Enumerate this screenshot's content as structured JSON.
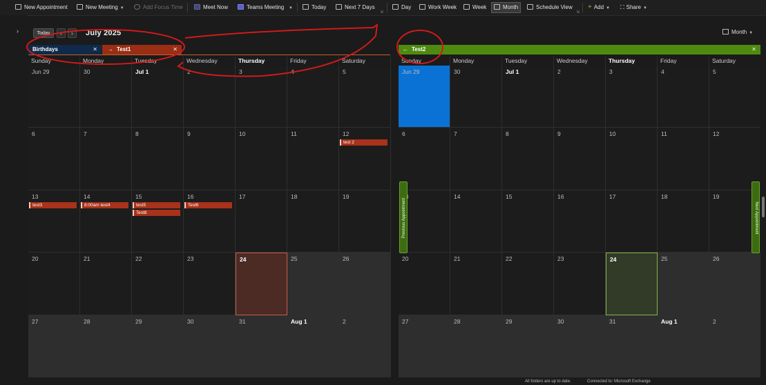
{
  "toolbar": {
    "new_appointment": "New Appointment",
    "new_meeting": "New Meeting",
    "add_focus_time": "Add Focus Time",
    "meet_now": "Meet Now",
    "teams_meeting": "Teams Meeting",
    "today": "Today",
    "next_7_days": "Next 7 Days",
    "day": "Day",
    "work_week": "Work Week",
    "week": "Week",
    "month": "Month",
    "schedule_view": "Schedule View",
    "add": "Add",
    "share": "Share"
  },
  "nav": {
    "today_btn": "Today",
    "month_title": "July 2025",
    "view_select": "Month",
    "expand_glyph": "›"
  },
  "left_calendar": {
    "tabs": [
      {
        "label": "Birthdays",
        "color": "#0f2a4a"
      },
      {
        "label": "Test1",
        "color": "#9a2e14"
      }
    ],
    "weekdays": [
      "Sunday",
      "Monday",
      "Tuesday",
      "Wednesday",
      "Thursday",
      "Friday",
      "Saturday"
    ],
    "weeks": [
      [
        "Jun 29",
        "30",
        "Jul 1",
        "2",
        "3",
        "4",
        "5"
      ],
      [
        "6",
        "7",
        "8",
        "9",
        "10",
        "11",
        "12"
      ],
      [
        "13",
        "14",
        "15",
        "16",
        "17",
        "18",
        "19"
      ],
      [
        "20",
        "21",
        "22",
        "23",
        "24",
        "25",
        "26"
      ],
      [
        "27",
        "28",
        "29",
        "30",
        "31",
        "Aug 1",
        "2"
      ]
    ],
    "events": [
      {
        "week": 1,
        "day": 6,
        "slot": 0,
        "label": "test 2"
      },
      {
        "week": 2,
        "day": 0,
        "slot": 0,
        "label": "test3"
      },
      {
        "week": 2,
        "day": 1,
        "slot": 0,
        "label": "8:00am test4"
      },
      {
        "week": 2,
        "day": 2,
        "slot": 0,
        "label": "test5"
      },
      {
        "week": 2,
        "day": 2,
        "slot": 1,
        "label": "Test8"
      },
      {
        "week": 2,
        "day": 3,
        "slot": 0,
        "label": "Test6"
      }
    ]
  },
  "right_calendar": {
    "tabs": [
      {
        "label": "Test2",
        "color": "#4f8a10"
      }
    ],
    "weekdays": [
      "Sunday",
      "Monday",
      "Tuesday",
      "Wednesday",
      "Thursday",
      "Friday",
      "Saturday"
    ],
    "weeks": [
      [
        "Jun 29",
        "30",
        "Jul 1",
        "2",
        "3",
        "4",
        "5"
      ],
      [
        "6",
        "7",
        "8",
        "9",
        "10",
        "11",
        "12"
      ],
      [
        "13",
        "14",
        "15",
        "16",
        "17",
        "18",
        "19"
      ],
      [
        "20",
        "21",
        "22",
        "23",
        "24",
        "25",
        "26"
      ],
      [
        "27",
        "28",
        "29",
        "30",
        "31",
        "Aug 1",
        "2"
      ]
    ],
    "prev_appointment": "Previous Appointment",
    "next_appointment": "Next Appointment"
  },
  "status": {
    "sync": "All folders are up to date.",
    "connection": "Connected to: Microsoft Exchange"
  },
  "colors": {
    "accent_left": "#a8321a",
    "accent_right": "#4f8a10",
    "selected_cell": "#0a72d4",
    "annotation": "#d11a1a"
  }
}
